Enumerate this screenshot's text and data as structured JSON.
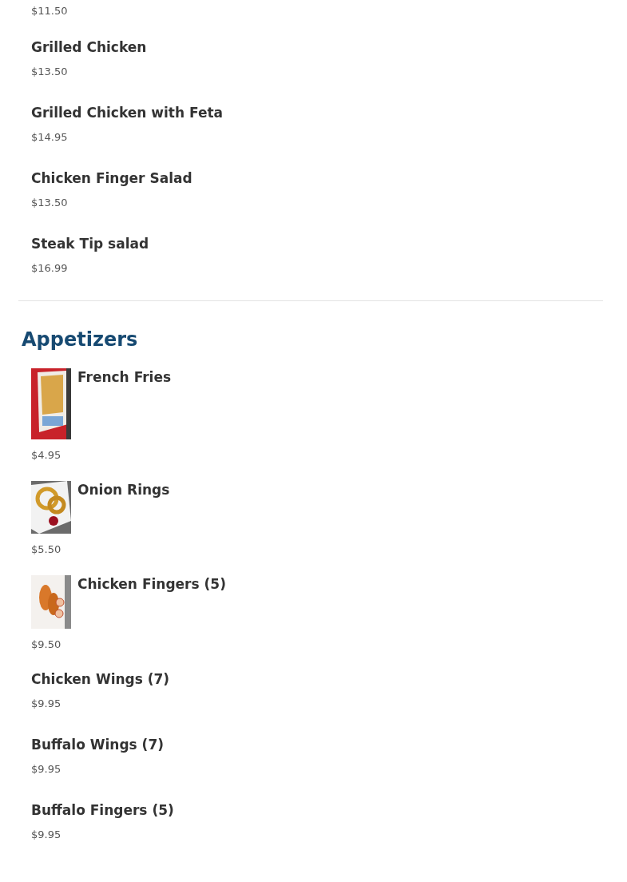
{
  "sections": [
    {
      "items": [
        {
          "price": "$11.50"
        },
        {
          "name": "Grilled Chicken",
          "price": "$13.50"
        },
        {
          "name": "Grilled Chicken with Feta",
          "price": "$14.95"
        },
        {
          "name": "Chicken Finger Salad",
          "price": "$13.50"
        },
        {
          "name": "Steak Tip salad",
          "price": "$16.99"
        }
      ]
    },
    {
      "title": "Appetizers",
      "items": [
        {
          "name": "French Fries",
          "price": "$4.95",
          "kind": "picture"
        },
        {
          "name": "Onion Rings",
          "price": "$5.50",
          "kind": "picture"
        },
        {
          "name": "Chicken Fingers (5)",
          "price": "$9.50",
          "kind": "picture"
        },
        {
          "name": "Chicken Wings (7)",
          "price": "$9.95"
        },
        {
          "name": "Buffalo Wings (7)",
          "price": "$9.95"
        },
        {
          "name": "Buffalo Fingers (5)",
          "price": "$9.95"
        }
      ]
    }
  ]
}
